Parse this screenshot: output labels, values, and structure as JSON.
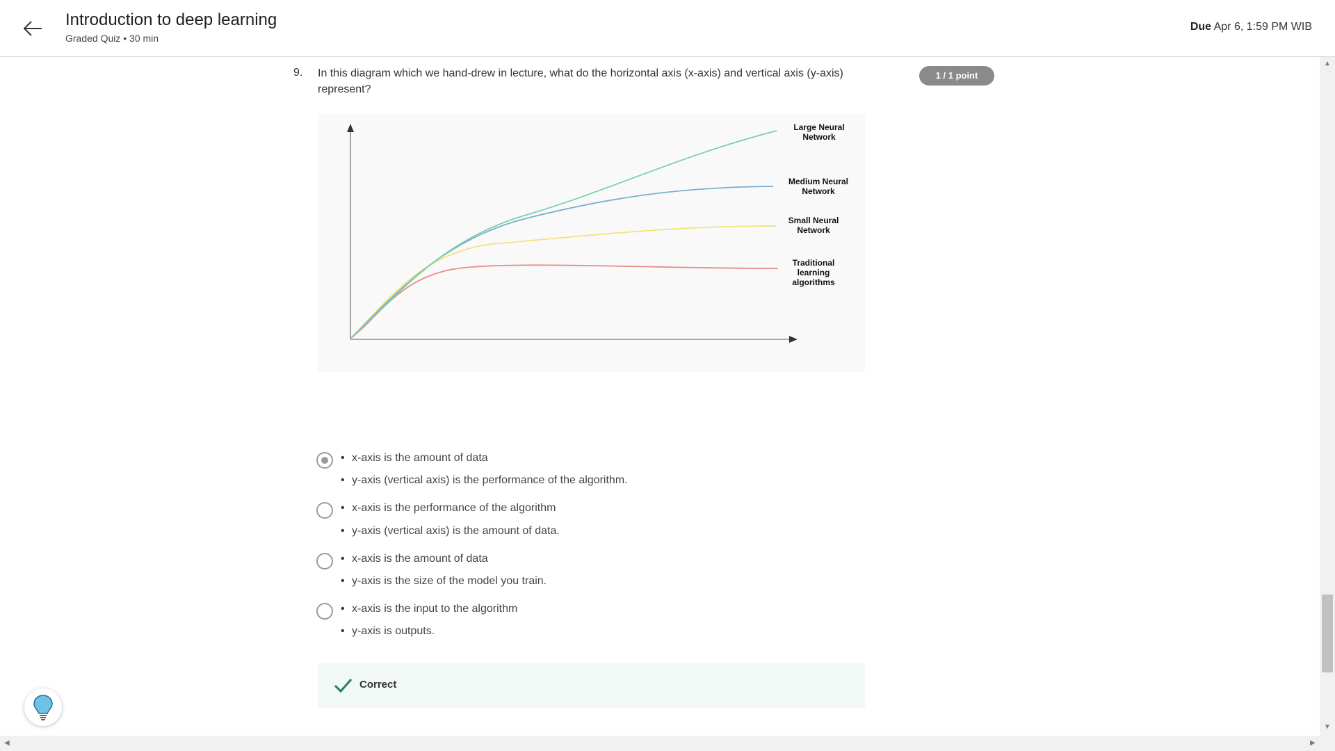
{
  "header": {
    "title": "Introduction to deep learning",
    "subtitle": "Graded Quiz • 30 min",
    "due_label": "Due",
    "due_value": "Apr 6, 1:59 PM WIB"
  },
  "question": {
    "number": "9.",
    "text": "In this diagram which we hand-drew in lecture, what do the horizontal axis (x-axis) and vertical axis (y-axis) represent?",
    "points": "1 / 1 point"
  },
  "diagram": {
    "labels": {
      "large": [
        "Large Neural",
        "Network"
      ],
      "medium": [
        "Medium Neural",
        "Network"
      ],
      "small": [
        "Small Neural",
        "Network"
      ],
      "traditional": [
        "Traditional",
        "learning",
        "algorithms"
      ]
    },
    "colors": {
      "large": "#7ccfa6",
      "medium": "#7aaed0",
      "small": "#f3e37a",
      "traditional": "#e88a86",
      "axis": "#777777"
    }
  },
  "options": [
    {
      "selected": true,
      "lines": [
        "x-axis is the amount of data",
        "y-axis (vertical axis) is the performance of the algorithm."
      ]
    },
    {
      "selected": false,
      "lines": [
        "x-axis is the performance of the algorithm",
        "y-axis (vertical axis) is the amount of data."
      ]
    },
    {
      "selected": false,
      "lines": [
        "x-axis is the amount of data",
        "y-axis is the size of the model you train."
      ]
    },
    {
      "selected": false,
      "lines": [
        "x-axis is the input to the algorithm",
        "y-axis is outputs."
      ]
    }
  ],
  "feedback": {
    "label": "Correct",
    "color": "#1f8354"
  }
}
